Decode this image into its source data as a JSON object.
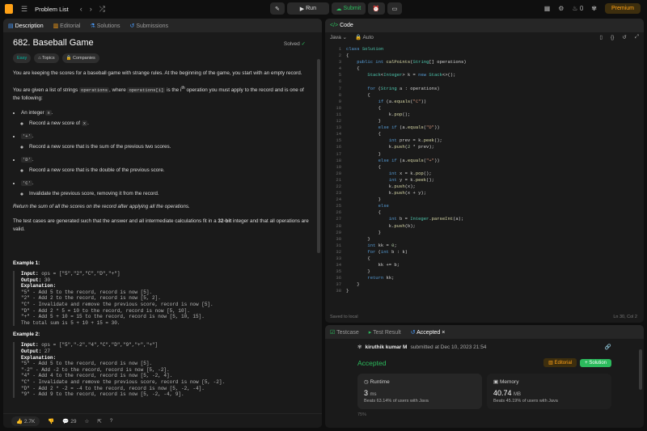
{
  "nav": {
    "title": "Problem List",
    "run": "Run",
    "submit": "Submit",
    "streak": "0",
    "premium": "Premium"
  },
  "left": {
    "tabs": [
      "Description",
      "Editorial",
      "Solutions",
      "Submissions"
    ],
    "title": "682. Baseball Game",
    "solved": "Solved",
    "chips": [
      "Easy",
      "Topics",
      "Companies"
    ],
    "p1": "You are keeping the scores for a baseball game with strange rules. At the beginning of the game, you start with an empty record.",
    "p2a": "You are given a list of strings ",
    "p2code": "operations",
    "p2b": ", where ",
    "p2code2": "operations[i]",
    "p2c": " is the i",
    "p2sup": "th",
    "p2d": " operation you must apply to the record and is one of the following:",
    "b1": "An integer ",
    "b1code": "x",
    "b1sub": "Record a new score of ",
    "b1subcode": "x",
    "b2code": "'+'",
    "b2sub": "Record a new score that is the sum of the previous two scores.",
    "b3code": "'D'",
    "b3sub": "Record a new score that is the double of the previous score.",
    "b4code": "'C'",
    "b4sub": "Invalidate the previous score, removing it from the record.",
    "p3": "Return the sum of all the scores on the record after applying all the operations.",
    "p4a": "The test cases are generated such that the answer and all intermediate calculations fit in a ",
    "p4b": "32-bit",
    "p4c": " integer and that all operations are valid.",
    "ex1": "Example 1:",
    "ex1in": "Input: ",
    "ex1inv": "ops = [\"5\",\"2\",\"C\",\"D\",\"+\"]",
    "ex1out": "Output: ",
    "ex1outv": "30",
    "ex1exp": "Explanation:",
    "ex1lines": "\"5\" - Add 5 to the record, record is now [5].\n\"2\" - Add 2 to the record, record is now [5, 2].\n\"C\" - Invalidate and remove the previous score, record is now [5].\n\"D\" - Add 2 * 5 = 10 to the record, record is now [5, 10].\n\"+\" - Add 5 + 10 = 15 to the record, record is now [5, 10, 15].\nThe total sum is 5 + 10 + 15 = 30.",
    "ex2": "Example 2:",
    "ex2in": "Input: ",
    "ex2inv": "ops = [\"5\",\"-2\",\"4\",\"C\",\"D\",\"9\",\"+\",\"+\"]",
    "ex2out": "Output: ",
    "ex2outv": "27",
    "ex2exp": "Explanation:",
    "ex2lines": "\"5\" - Add 5 to the record, record is now [5].\n\"-2\" - Add -2 to the record, record is now [5, -2].\n\"4\" - Add 4 to the record, record is now [5, -2, 4].\n\"C\" - Invalidate and remove the previous score, record is now [5, -2].\n\"D\" - Add 2 * -2 = -4 to the record, record is now [5, -2, -4].\n\"9\" - Add 9 to the record, record is now [5, -2, -4, 9].",
    "likes": "2.7K",
    "comments": "29"
  },
  "code": {
    "tab": "Code",
    "lang": "Java",
    "auto": "Auto",
    "saved": "Saved to local",
    "pos": "Ln 30, Col 2"
  },
  "result": {
    "tabs": [
      "Testcase",
      "Test Result",
      "Accepted"
    ],
    "user": "kiruthik kumar M",
    "when": "submitted at Dec 10, 2023 21:54",
    "status": "Accepted",
    "editorial": "Editorial",
    "solution": "Solution",
    "runtime_label": "Runtime",
    "runtime": "3",
    "runtime_unit": "ms",
    "runtime_beats": "Beats 63.14% of users with Java",
    "memory_label": "Memory",
    "memory": "40.74",
    "memory_unit": "MB",
    "memory_beats": "Beats 45.19% of users with Java",
    "pct": "75%"
  }
}
